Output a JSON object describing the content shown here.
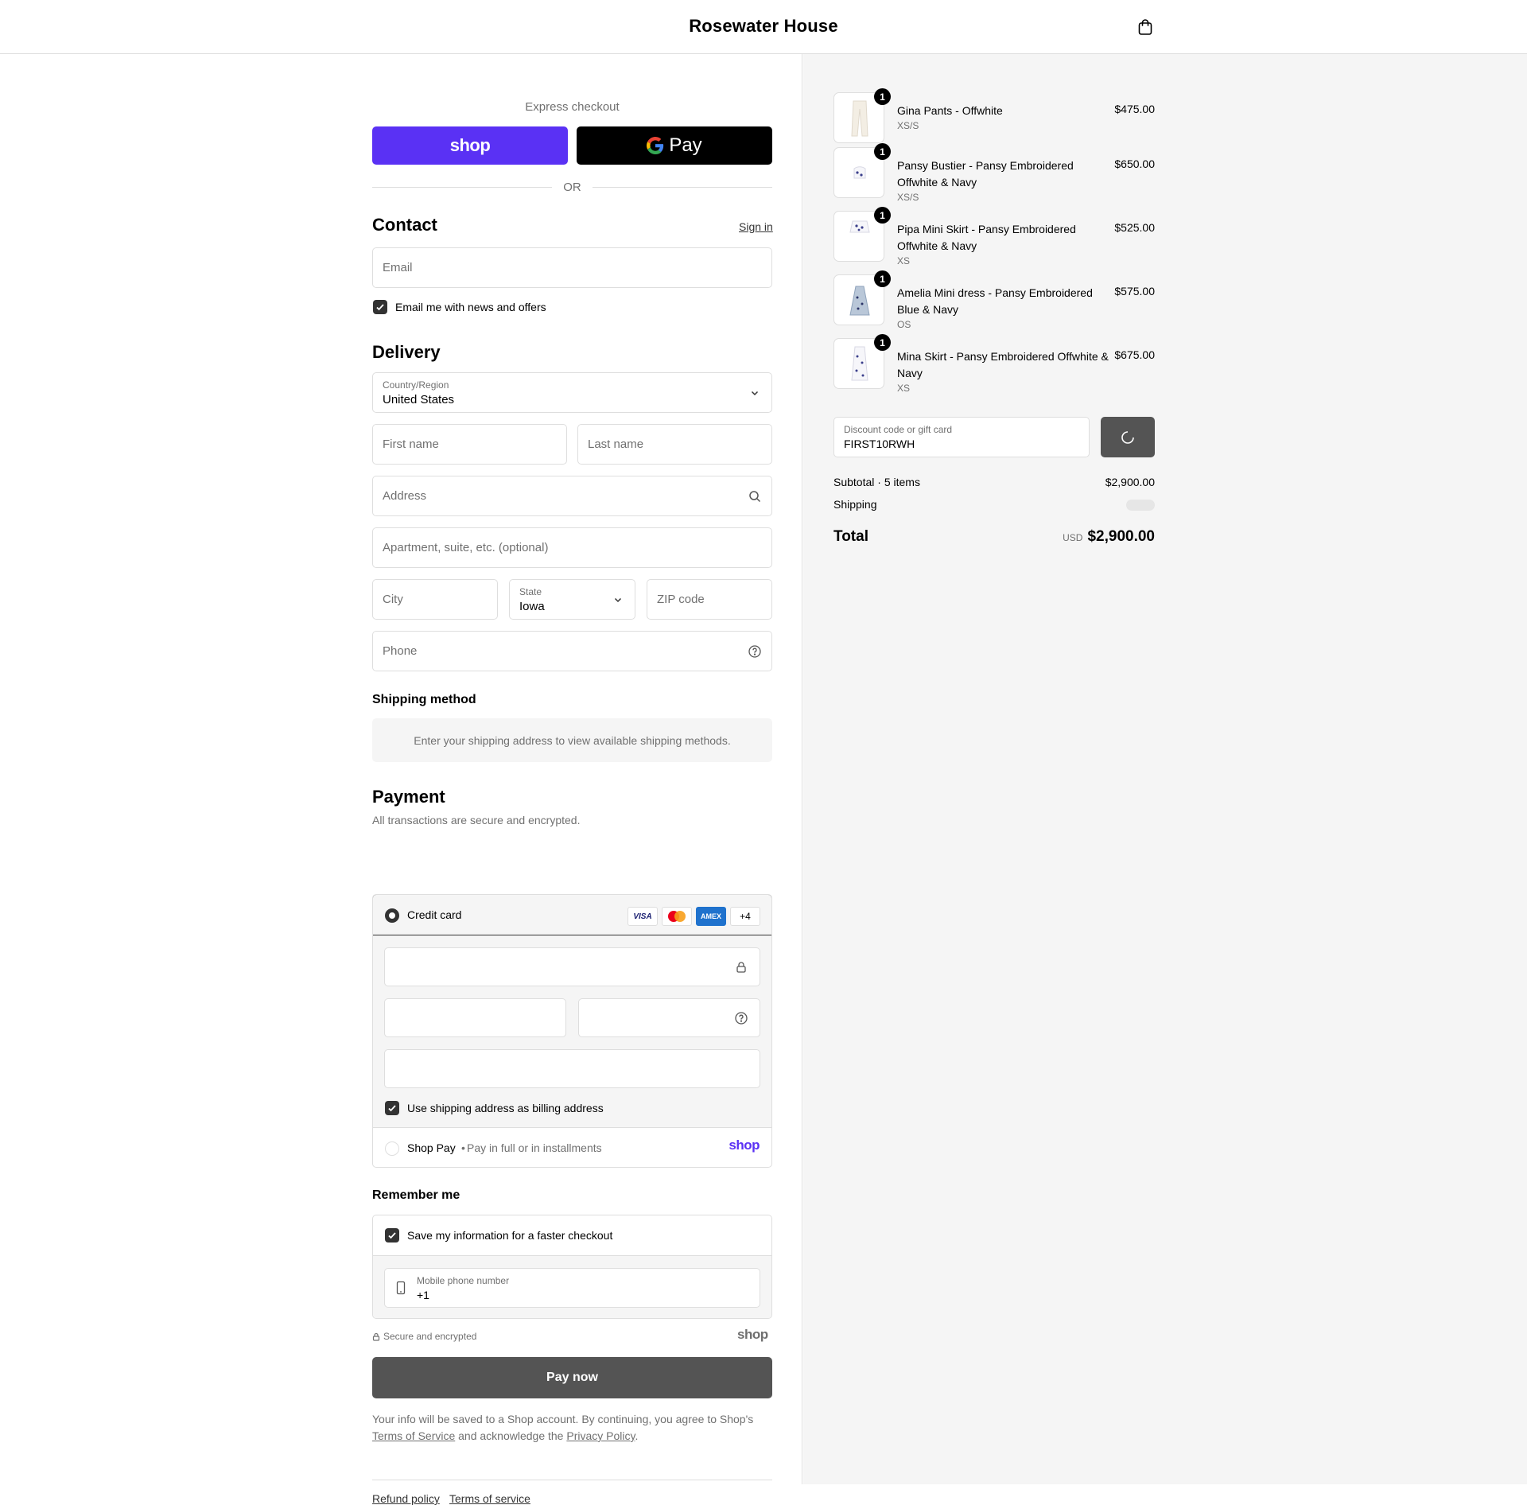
{
  "header": {
    "store_name": "Rosewater House",
    "cart_icon": "shopping-bag-icon"
  },
  "express": {
    "label": "Express checkout",
    "shop_pay_label": "shop",
    "gpay_label": "Pay",
    "divider": "OR",
    "colors": {
      "shop": "#5a31f4",
      "gpay": "#000000"
    }
  },
  "contact": {
    "title": "Contact",
    "sign_in": "Sign in",
    "email_placeholder": "Email",
    "news_label": "Email me with news and offers",
    "news_checked": true
  },
  "delivery": {
    "title": "Delivery",
    "country_label": "Country/Region",
    "country_value": "United States",
    "first_name_placeholder": "First name",
    "last_name_placeholder": "Last name",
    "address_placeholder": "Address",
    "apartment_placeholder": "Apartment, suite, etc. (optional)",
    "city_placeholder": "City",
    "state_label": "State",
    "state_value": "Iowa",
    "zip_placeholder": "ZIP code",
    "phone_placeholder": "Phone"
  },
  "shipping_method": {
    "title": "Shipping method",
    "info": "Enter your shipping address to view available shipping methods."
  },
  "payment": {
    "title": "Payment",
    "subtitle": "All transactions are secure and encrypted.",
    "credit_card_label": "Credit card",
    "brands": [
      "VISA",
      "mastercard",
      "AMEX",
      "+4"
    ],
    "billing_label": "Use shipping address as billing address",
    "billing_checked": true,
    "shop_pay_label": "Shop Pay",
    "shop_pay_desc": "Pay in full or in installments",
    "shop_logo": "shop"
  },
  "remember": {
    "title": "Remember me",
    "save_label": "Save my information for a faster checkout",
    "save_checked": true,
    "mobile_label": "Mobile phone number",
    "mobile_value": "+1"
  },
  "secure": {
    "label": "Secure and encrypted",
    "shop_logo": "shop"
  },
  "pay_now": "Pay now",
  "legal": {
    "text_1": "Your info will be saved to a Shop account. By continuing, you agree to Shop's",
    "terms": "Terms of Service",
    "text_2": "and acknowledge the",
    "privacy": "Privacy Policy",
    "text_3": "."
  },
  "footer": {
    "refund": "Refund policy",
    "terms": "Terms of service"
  },
  "order": {
    "items": [
      {
        "name": "Gina Pants - Offwhite",
        "variant": "XS/S",
        "price": "$475.00",
        "qty": "1"
      },
      {
        "name": "Pansy Bustier - Pansy Embroidered Offwhite & Navy",
        "variant": "XS/S",
        "price": "$650.00",
        "qty": "1"
      },
      {
        "name": "Pipa Mini Skirt - Pansy Embroidered Offwhite & Navy",
        "variant": "XS",
        "price": "$525.00",
        "qty": "1"
      },
      {
        "name": "Amelia Mini dress - Pansy Embroidered Blue & Navy",
        "variant": "OS",
        "price": "$575.00",
        "qty": "1"
      },
      {
        "name": "Mina Skirt - Pansy Embroidered Offwhite & Navy",
        "variant": "XS",
        "price": "$675.00",
        "qty": "1"
      }
    ],
    "discount_label": "Discount code or gift card",
    "discount_value": "FIRST10RWH",
    "subtotal_label": "Subtotal · 5 items",
    "subtotal_value": "$2,900.00",
    "shipping_label": "Shipping",
    "total_label": "Total",
    "currency": "USD",
    "total_value": "$2,900.00"
  }
}
